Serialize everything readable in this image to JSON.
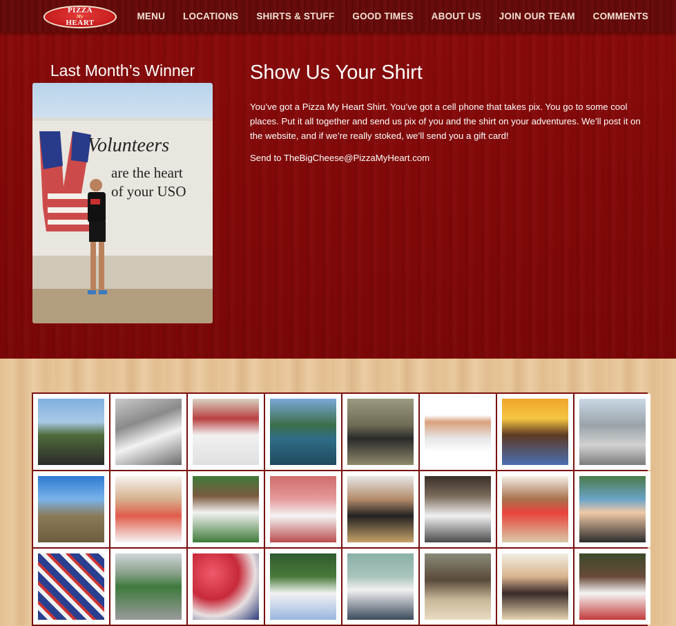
{
  "nav": {
    "logo_line1": "PIZZA",
    "logo_line2": "My",
    "logo_line3": "HEART",
    "items": [
      {
        "label": "MENU"
      },
      {
        "label": "LOCATIONS"
      },
      {
        "label": "SHIRTS & STUFF"
      },
      {
        "label": "GOOD TIMES"
      },
      {
        "label": "ABOUT US"
      },
      {
        "label": "JOIN OUR TEAM"
      },
      {
        "label": "COMMENTS"
      }
    ]
  },
  "winner": {
    "title": "Last Month’s Winner",
    "sign_line1": "Volunteers",
    "sign_line2": "are the heart",
    "sign_line3": "of your USO"
  },
  "main": {
    "title": "Show Us Your Shirt",
    "paragraph": "You’ve got a Pizza My Heart Shirt.  You’ve got a cell phone that takes pix.  You go to some cool places.  Put it all together and send us pix of you and the shirt on your adventures.  We’ll post it on the website, and if we’re really stoked, we’ll send you a gift card!",
    "send_to": "Send to TheBigCheese@PizzaMyHeart.com"
  },
  "colors": {
    "hero_bg": "#7d0707",
    "nav_bg": "#5e0909",
    "grid_border": "#7a0d0d",
    "nav_text": "#f3e3d3"
  }
}
